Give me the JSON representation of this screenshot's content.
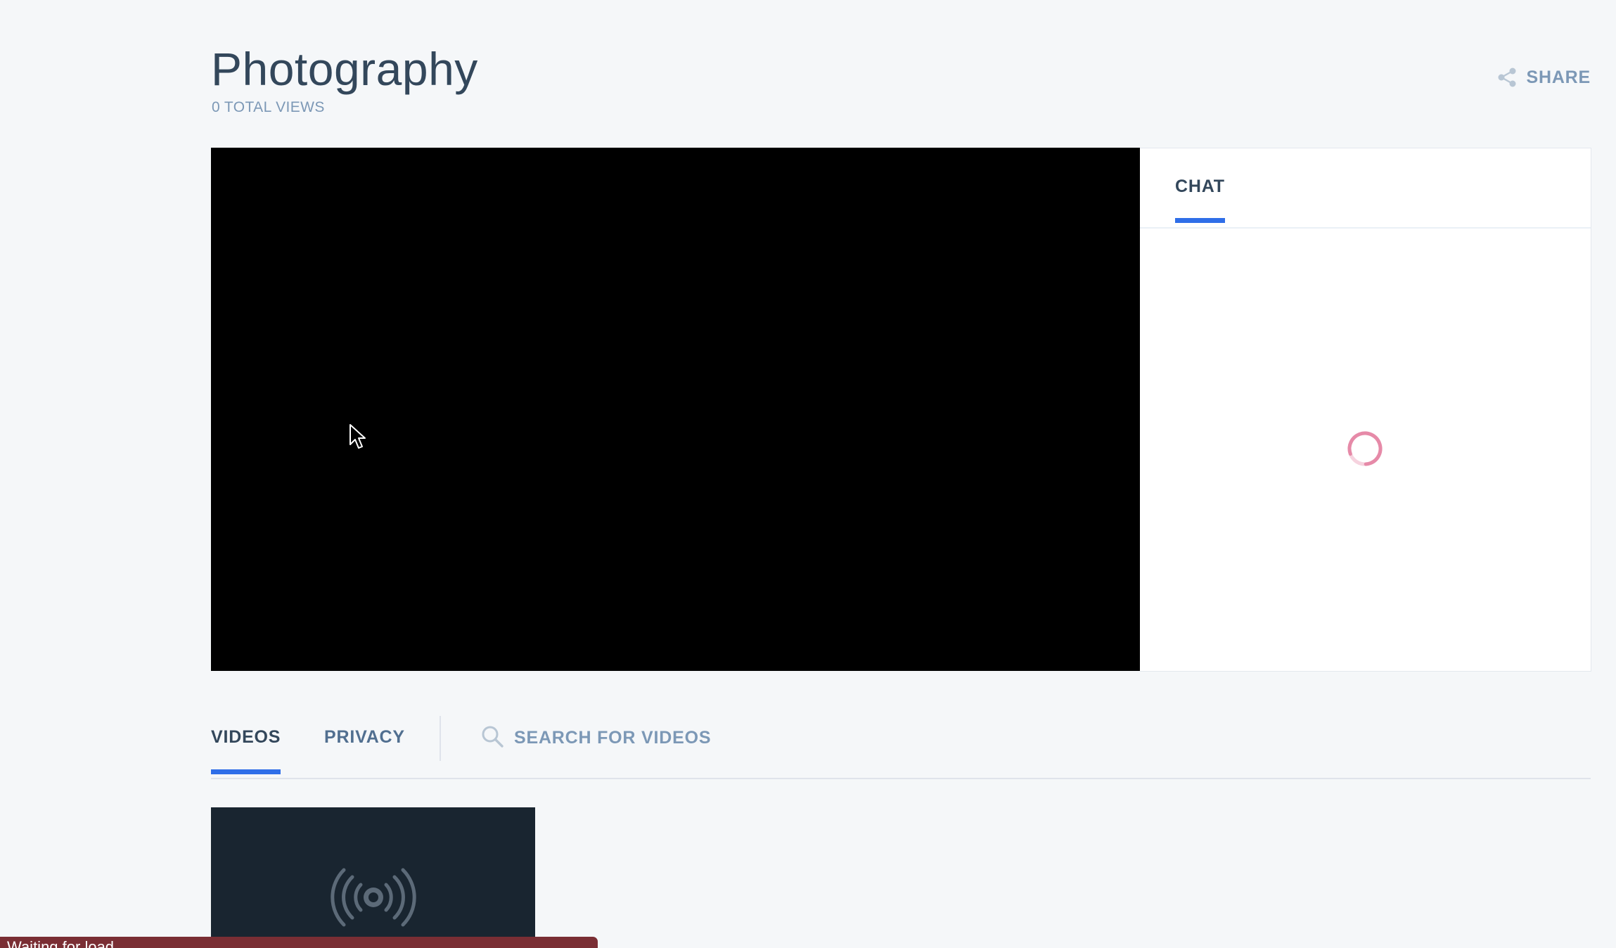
{
  "header": {
    "title": "Photography",
    "total_views": "0 TOTAL VIEWS",
    "share_label": "SHARE"
  },
  "chat": {
    "tab_label": "CHAT",
    "loading": true
  },
  "tabs": [
    {
      "label": "VIDEOS",
      "active": true
    },
    {
      "label": "PRIVACY",
      "active": false
    }
  ],
  "search": {
    "placeholder": "SEARCH FOR VIDEOS",
    "value": ""
  },
  "videos": [
    {
      "icon": "broadcast-icon"
    }
  ],
  "status": {
    "text": "Waiting for load..."
  },
  "colors": {
    "accent": "#2f6ee8",
    "player_bg": "#000000",
    "spinner": "#e68aa8",
    "status_bar": "#7a2e34",
    "video_thumb": "#192530"
  }
}
